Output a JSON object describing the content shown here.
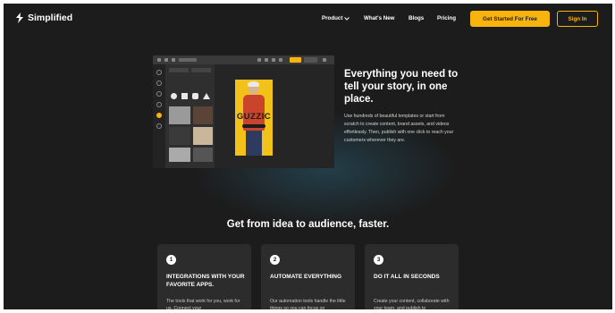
{
  "nav": {
    "logo_text": "Simplified",
    "links": [
      {
        "label": "Product",
        "has_dropdown": true
      },
      {
        "label": "What's New"
      },
      {
        "label": "Blogs"
      },
      {
        "label": "Pricing"
      }
    ],
    "cta_label": "Get Started For Free",
    "signin_label": "Sign In"
  },
  "hero": {
    "title": "Everything you need to tell your story, in one place.",
    "body": "Use hundreds of beautiful templates or start from scratch to create content, brand assets, and videos effortlessly. Then, publish with one click to reach your customers wherever they are.",
    "mockup": {
      "poster_title": "GUZZIC"
    }
  },
  "section": {
    "title": "Get from idea to audience, faster.",
    "cards": [
      {
        "number": "1",
        "title": "INTEGRATIONS WITH YOUR FAVORITE APPS.",
        "desc": "The tools that work for you, work for us. Connect your"
      },
      {
        "number": "2",
        "title": "AUTOMATE EVERYTHING",
        "desc": "Our automation tools handle the little things so you can focus on"
      },
      {
        "number": "3",
        "title": "DO IT ALL IN SECONDS",
        "desc": "Create your content, collaborate with your team, and publish to"
      }
    ]
  },
  "colors": {
    "background": "#1c1c1c",
    "accent": "#f9b30d",
    "card": "#2c2c2c"
  }
}
